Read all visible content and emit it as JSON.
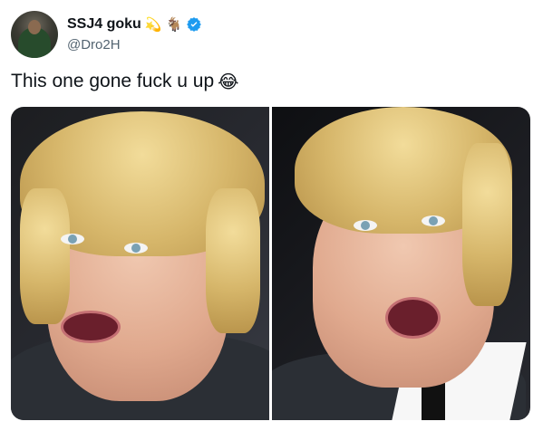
{
  "tweet": {
    "display_name": "SSJ4 goku",
    "handle": "@Dro2H",
    "name_emojis": [
      "💫",
      "🐐"
    ],
    "verified_icon": "verified-badge-icon",
    "text": "This one gone fuck u up",
    "text_emoji": "😂"
  },
  "colors": {
    "verified_blue": "#1d9bf0",
    "handle_gray": "#536471",
    "text": "#0f1419"
  }
}
